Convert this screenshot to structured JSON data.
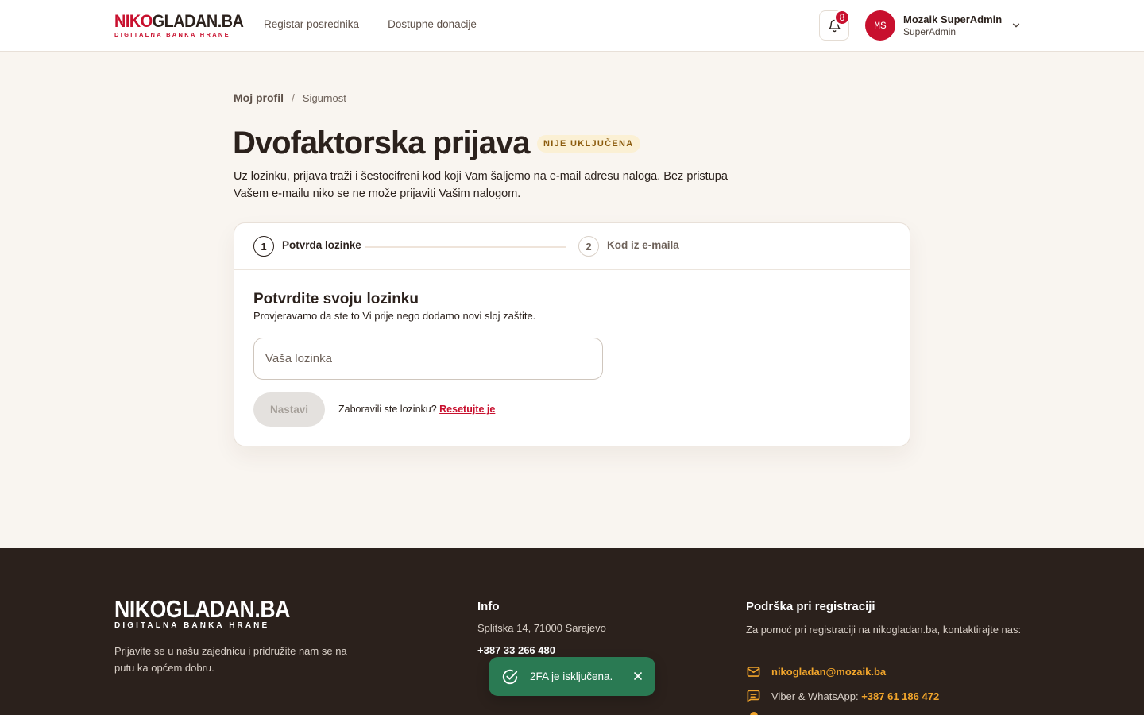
{
  "header": {
    "logo": {
      "part_red": "NIKO",
      "part_dark": "GLADAN.BA",
      "tagline": "DIGITALNA BANKA HRANE"
    },
    "nav": [
      {
        "label": "Registar posrednika"
      },
      {
        "label": "Dostupne donacije"
      }
    ],
    "notifications": {
      "count": "8",
      "icon": "bell-icon"
    },
    "user": {
      "initials": "MS",
      "name": "Mozaik SuperAdmin",
      "role": "SuperAdmin"
    }
  },
  "breadcrumb": {
    "parent": "Moj profil",
    "separator": "/",
    "current": "Sigurnost"
  },
  "page": {
    "title": "Dvofaktorska prijava",
    "status": "NIJE UKLJUČENA",
    "description": "Uz lozinku, prijava traži i šestocifreni kod koji Vam šaljemo na e-mail adresu naloga. Bez pristupa Vašem e-mailu niko se ne može prijaviti Vašim nalogom."
  },
  "stepper": {
    "steps": [
      {
        "number": "1",
        "label": "Potvrda lozinke",
        "state": "active"
      },
      {
        "number": "2",
        "label": "Kod iz e-maila",
        "state": "inactive"
      }
    ]
  },
  "form": {
    "title": "Potvrdite svoju lozinku",
    "subtitle": "Provjeravamo da ste to Vi prije nego dodamo novi sloj zaštite.",
    "password_placeholder": "Vaša lozinka",
    "password_value": "",
    "submit_label": "Nastavi",
    "submit_disabled": true,
    "forgot_text": "Zaboravili ste lozinku?",
    "forgot_link": "Resetujte je"
  },
  "footer": {
    "logo": {
      "title": "NIKOGLADAN.BA",
      "tagline": "DIGITALNA BANKA HRANE"
    },
    "tagline": "Prijavite se u našu zajednicu i pridružite nam se na putu ka općem dobru.",
    "info": {
      "title": "Info",
      "address": "Splitska 14, 71000 Sarajevo",
      "phone": "+387 33 266 480"
    },
    "support": {
      "title": "Podrška pri registraciji",
      "text": "Za pomoć pri registraciji na nikogladan.ba, kontaktirajte nas:",
      "email": "nikogladan@mozaik.ba",
      "viber_label": "Viber & WhatsApp:",
      "viber_number": "+387 61 186 472"
    }
  },
  "toast": {
    "message": "2FA je isključena.",
    "icon": "check-circle-icon"
  },
  "colors": {
    "brand_red": "#c8102e",
    "background": "#f9f5f0",
    "footer_bg": "#2b211c",
    "accent_orange": "#f1a52b",
    "toast_green": "#2a7a53",
    "badge_bg": "#fbf0d4"
  }
}
